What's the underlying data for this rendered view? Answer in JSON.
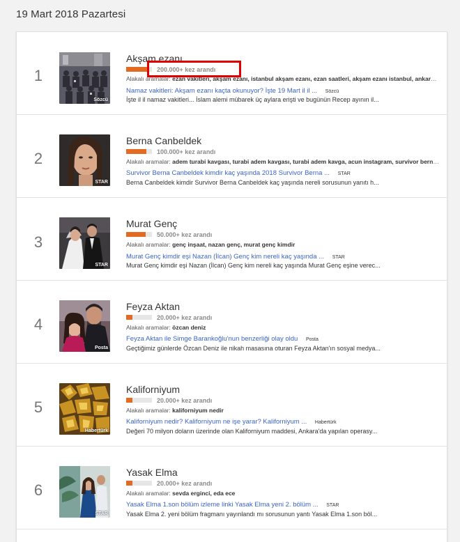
{
  "date": "19 Mart 2018 Pazartesi",
  "items": [
    {
      "rank": "1",
      "title": "Akşam ezanı",
      "count": "200.000+ kez arandı",
      "progress": 0.82,
      "related_prefix": "Alakalı aramalar:",
      "related": "ezan vakitleri, akşam ezanı, istanbul akşam ezanı, ezan saatleri, akşam ezanı istanbul, ankara akşam ezanı",
      "article_title": "Namaz vakitleri: Akşam ezanı kaçta okunuyor? İşte 19 Mart il il ...",
      "article_source": "Sözcü",
      "snippet": "İşte il il namaz vakitleri... İslam alemi mübarek üç aylara erişti ve bugünün Recep ayının il...",
      "thumb_source": "Sözcü"
    },
    {
      "rank": "2",
      "title": "Berna Canbeldek",
      "count": "100.000+ kez arandı",
      "progress": 0.78,
      "related_prefix": "Alakalı aramalar:",
      "related": "adem turabi kavgası, turabi adem kavgası, turabi adem kavga, acun instagram, survivor berna, acun ilıcalı instagram",
      "article_title": "Survivor Berna Canbeldek kimdir kaç yaşında 2018 Survivor Berna ...",
      "article_source": "STAR",
      "snippet": "Berna Canbeldek kimdir Survivor Berna Canbeldek kaç yaşında nereli sorusunun yanıtı h...",
      "thumb_source": "STAR"
    },
    {
      "rank": "3",
      "title": "Murat Genç",
      "count": "50.000+ kez arandı",
      "progress": 0.75,
      "related_prefix": "Alakalı aramalar:",
      "related": "genç inşaat, nazan genç, murat genç kimdir",
      "article_title": "Murat Genç kimdir eşi Nazan (İlcan) Genç kim nereli kaç yaşında ...",
      "article_source": "STAR",
      "snippet": "Murat Genç kimdir eşi Nazan (İlcan) Genç kim nereli kaç yaşında Murat Genç eşine verec...",
      "thumb_source": "STAR"
    },
    {
      "rank": "4",
      "title": "Feyza Aktan",
      "count": "20.000+ kez arandı",
      "progress": 0.25,
      "related_prefix": "Alakalı aramalar:",
      "related": "özcan deniz",
      "article_title": "Feyza Aktan ile Simge Barankoğlu'nun benzerliği olay oldu",
      "article_source": "Posta",
      "snippet": "Geçtiğimiz günlerde Özcan Deniz ile nikah masasına oturan Feyza Aktan'ın sosyal medya...",
      "thumb_source": "Posta"
    },
    {
      "rank": "5",
      "title": "Kaliforniyum",
      "count": "20.000+ kez arandı",
      "progress": 0.25,
      "related_prefix": "Alakalı aramalar:",
      "related": "kaliforniyum nedir",
      "article_title": "Kaliforniyum nedir? Kaliforniyum ne işe yarar? Kaliforniyum ...",
      "article_source": "Habertürk",
      "snippet": "Değeri 70 milyon doların üzerinde olan Kaliforniyum maddesi, Ankara'da yapılan operasy...",
      "thumb_source": "Habertürk"
    },
    {
      "rank": "6",
      "title": "Yasak Elma",
      "count": "20.000+ kez arandı",
      "progress": 0.25,
      "related_prefix": "Alakalı aramalar:",
      "related": "sevda erginci, eda ece",
      "article_title": "Yasak Elma 1.son bölüm izleme linki Yasak Elma yeni 2. bölüm ...",
      "article_source": "STAR",
      "snippet": "Yasak Elma 2. yeni bölüm fragmanı yayınlandı mı sorusunun yantı Yasak Elma 1.son böl...",
      "thumb_source": "STAR"
    }
  ]
}
